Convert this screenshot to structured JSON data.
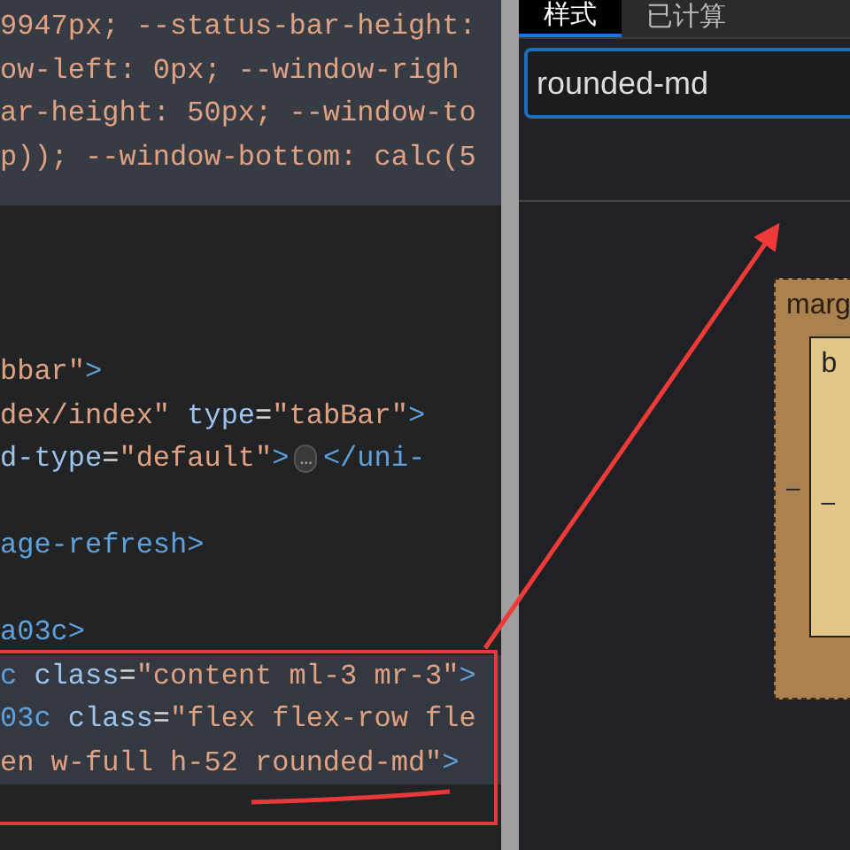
{
  "style_text": {
    "lines": [
      "9947px; --status-bar-height:",
      "ow-left: 0px; --window-righ",
      "ar-height: 50px; --window-to",
      "p)); --window-bottom: calc(5"
    ]
  },
  "dom_tree": {
    "lines": [
      {
        "kind": "code",
        "selected": false,
        "segments": [
          {
            "kind": "value",
            "text": "bbar\""
          },
          {
            "kind": "tag",
            "text": ">"
          }
        ]
      },
      {
        "kind": "code",
        "selected": false,
        "segments": [
          {
            "kind": "value",
            "text": "dex/index\" "
          },
          {
            "kind": "name",
            "text": "type"
          },
          {
            "kind": "punct",
            "text": "="
          },
          {
            "kind": "value",
            "text": "\"tabBar\""
          },
          {
            "kind": "tag",
            "text": ">"
          }
        ]
      },
      {
        "kind": "code",
        "selected": false,
        "segments": [
          {
            "kind": "name",
            "text": "d-type"
          },
          {
            "kind": "punct",
            "text": "="
          },
          {
            "kind": "value",
            "text": "\"default\""
          },
          {
            "kind": "tag",
            "text": ">"
          },
          {
            "kind": "ellipsis",
            "text": "…"
          },
          {
            "kind": "tag",
            "text": "</uni-"
          }
        ]
      },
      {
        "kind": "blank",
        "selected": false
      },
      {
        "kind": "code",
        "selected": false,
        "segments": [
          {
            "kind": "tag",
            "text": "age-refresh>"
          }
        ]
      },
      {
        "kind": "blank",
        "selected": false
      },
      {
        "kind": "code",
        "selected": false,
        "segments": [
          {
            "kind": "tag",
            "text": "a03c>"
          }
        ]
      },
      {
        "kind": "code",
        "selected": true,
        "segments": [
          {
            "kind": "tag",
            "text": "c "
          },
          {
            "kind": "name",
            "text": "class"
          },
          {
            "kind": "punct",
            "text": "="
          },
          {
            "kind": "value",
            "text": "\"content ml-3 mr-3\""
          },
          {
            "kind": "tag",
            "text": ">"
          }
        ]
      },
      {
        "kind": "code",
        "selected": true,
        "segments": [
          {
            "kind": "tag",
            "text": "03c "
          },
          {
            "kind": "name",
            "text": "class"
          },
          {
            "kind": "punct",
            "text": "="
          },
          {
            "kind": "value",
            "text": "\"flex flex-row fle"
          }
        ]
      },
      {
        "kind": "code",
        "selected": true,
        "segments": [
          {
            "kind": "value",
            "text": "en w-full h-52 rounded-md\""
          },
          {
            "kind": "tag",
            "text": ">"
          }
        ]
      }
    ]
  },
  "tabs": [
    {
      "label": "样式",
      "selected": true
    },
    {
      "label": "已计算",
      "selected": false
    }
  ],
  "filter": {
    "value": "rounded-md"
  },
  "box_model": {
    "margin_label": "marg",
    "margin_value": "–",
    "border_label": "b",
    "border_value": "–"
  }
}
